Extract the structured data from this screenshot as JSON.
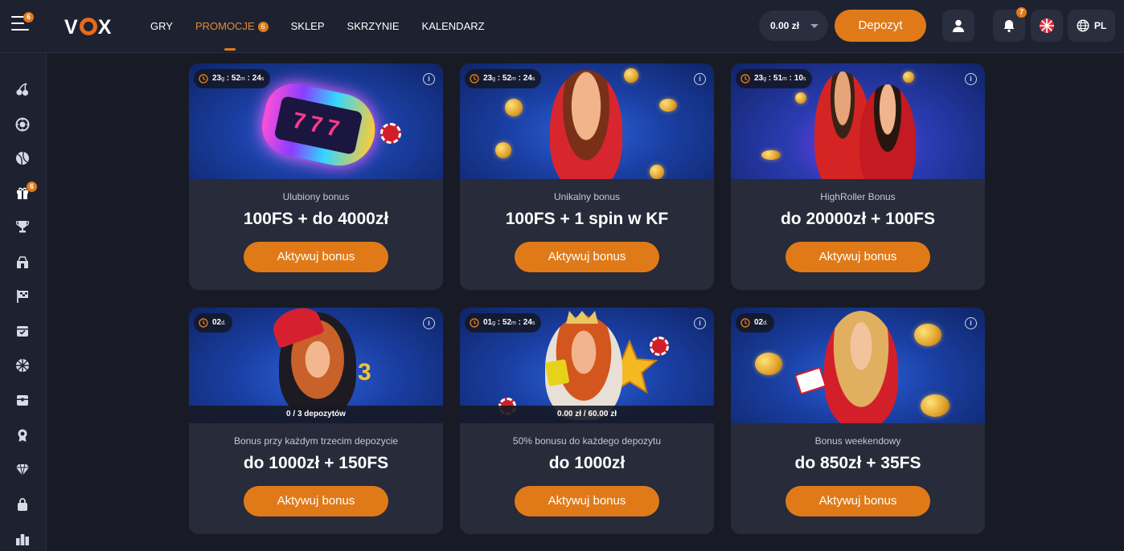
{
  "brand": {
    "logo_text_left": "V",
    "logo_text_right": "X",
    "accent": "#e07a18"
  },
  "menu_badge": "6",
  "nav": [
    {
      "label": "GRY"
    },
    {
      "label": "PROMOCJE",
      "badge": "6"
    },
    {
      "label": "SKLEP"
    },
    {
      "label": "SKRZYNIE"
    },
    {
      "label": "KALENDARZ"
    }
  ],
  "header": {
    "balance": "0.00 zł",
    "deposit_label": "Depozyt",
    "notifications_badge": "7",
    "language": "PL"
  },
  "sidebar": {
    "items": [
      {
        "icon": "cherries-icon"
      },
      {
        "icon": "roulette-icon"
      },
      {
        "icon": "sports-ball-icon"
      },
      {
        "icon": "gift-icon",
        "badge": "6"
      },
      {
        "icon": "trophy-icon"
      },
      {
        "icon": "shop-icon"
      },
      {
        "icon": "race-flag-icon"
      },
      {
        "icon": "calendar-icon"
      },
      {
        "icon": "wheel-icon"
      },
      {
        "icon": "chest-icon"
      },
      {
        "icon": "award-icon"
      },
      {
        "icon": "diamond-icon"
      },
      {
        "icon": "lock-bag-icon"
      },
      {
        "icon": "leaderboard-icon"
      }
    ]
  },
  "promotions": [
    {
      "timer": {
        "d": "23",
        "du": "g",
        "h": "52",
        "hu": "m",
        "m": "24",
        "mu": "s"
      },
      "subtitle": "Ulubiony bonus",
      "title": "100FS + do 4000zł",
      "cta": "Aktywuj bonus",
      "art": "slot-reels"
    },
    {
      "timer": {
        "d": "23",
        "du": "g",
        "h": "52",
        "hu": "m",
        "m": "24",
        "mu": "s"
      },
      "subtitle": "Unikalny bonus",
      "title": "100FS + 1 spin w KF",
      "cta": "Aktywuj bonus",
      "art": "woman-coins"
    },
    {
      "timer": {
        "d": "23",
        "du": "g",
        "h": "51",
        "hu": "m",
        "m": "10",
        "mu": "s"
      },
      "subtitle": "HighRoller Bonus",
      "title": "do 20000zł + 100FS",
      "cta": "Aktywuj bonus",
      "art": "couple-money"
    },
    {
      "timer_days": "02",
      "timer_days_unit": "d.",
      "progress": "0 / 3 depozytów",
      "subtitle": "Bonus przy każdym trzecim depozycie",
      "title": "do 1000zł + 150FS",
      "cta": "Aktywuj bonus",
      "art": "jester"
    },
    {
      "timer": {
        "d": "01",
        "du": "g",
        "h": "52",
        "hu": "m",
        "m": "24",
        "mu": "s"
      },
      "progress": "0.00 zł / 60.00 zł",
      "subtitle": "50% bonusu do każdego depozytu",
      "title": "do 1000zł",
      "cta": "Aktywuj bonus",
      "art": "queen-star"
    },
    {
      "timer_days": "02",
      "timer_days_unit": "d.",
      "subtitle": "Bonus weekendowy",
      "title": "do 850zł + 35FS",
      "cta": "Aktywuj bonus",
      "art": "woman-cards"
    }
  ]
}
